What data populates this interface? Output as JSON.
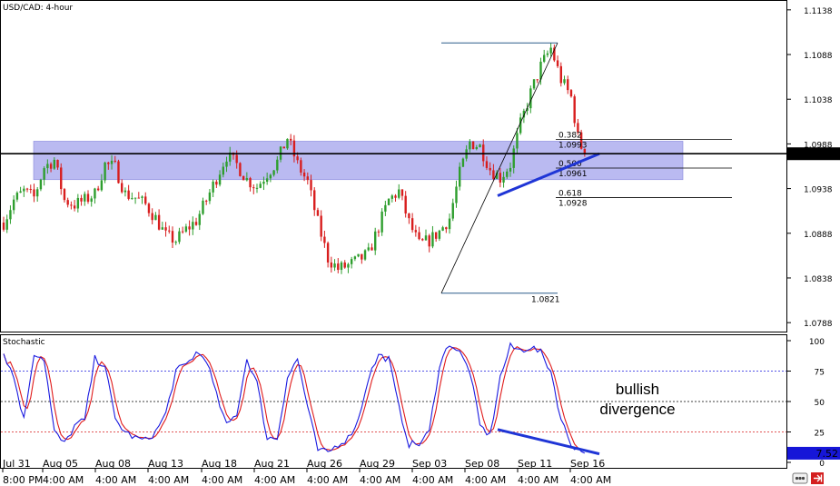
{
  "chart_data": [
    {
      "type": "candlestick",
      "title": "USD/CAD: 4-hour",
      "ylim": [
        1.0778,
        1.1148
      ],
      "y_ticks": [
        "1.1138",
        "1.1088",
        "1.1038",
        "1.0988",
        "1.0938",
        "1.0888",
        "1.0838",
        "1.0788"
      ],
      "y_tick_values": [
        1.1138,
        1.1088,
        1.1038,
        1.0988,
        1.0938,
        1.0888,
        1.0838,
        1.0788
      ],
      "current_price": "1.0977",
      "current_price_value": 1.0977,
      "support_zone": {
        "low": 1.0948,
        "high": 1.0991
      },
      "swing_low": {
        "value": 1.0821,
        "label": "1.0821"
      },
      "swing_high": {
        "value": 1.1101
      },
      "fib_levels": [
        {
          "ratio": "0.382",
          "price": "1.0993",
          "value": 1.0993
        },
        {
          "ratio": "0.500",
          "price": "1.0961",
          "value": 1.0961
        },
        {
          "ratio": "0.618",
          "price": "1.0928",
          "value": 1.0928
        }
      ],
      "anchors": [
        [
          0,
          1.09
        ],
        [
          3,
          1.0925
        ],
        [
          6,
          1.0935
        ],
        [
          9,
          1.0928
        ],
        [
          12,
          1.0962
        ],
        [
          15,
          1.097
        ],
        [
          18,
          1.0925
        ],
        [
          21,
          1.092
        ],
        [
          24,
          1.0925
        ],
        [
          27,
          1.0932
        ],
        [
          30,
          1.0965
        ],
        [
          33,
          1.0962
        ],
        [
          36,
          1.0932
        ],
        [
          39,
          1.0928
        ],
        [
          42,
          1.092
        ],
        [
          45,
          1.0905
        ],
        [
          48,
          1.0885
        ],
        [
          51,
          1.088
        ],
        [
          54,
          1.0892
        ],
        [
          57,
          1.0902
        ],
        [
          60,
          1.0925
        ],
        [
          63,
          1.095
        ],
        [
          66,
          1.0975
        ],
        [
          69,
          1.0965
        ],
        [
          72,
          1.0948
        ],
        [
          75,
          1.094
        ],
        [
          78,
          1.0955
        ],
        [
          81,
          1.0968
        ],
        [
          84,
          1.0995
        ],
        [
          87,
          1.0965
        ],
        [
          90,
          1.0945
        ],
        [
          93,
          1.09
        ],
        [
          96,
          1.086
        ],
        [
          99,
          1.0848
        ],
        [
          102,
          1.0852
        ],
        [
          105,
          1.0858
        ],
        [
          108,
          1.0865
        ],
        [
          111,
          1.0895
        ],
        [
          114,
          1.0925
        ],
        [
          117,
          1.0935
        ],
        [
          120,
          1.09
        ],
        [
          123,
          1.0875
        ],
        [
          126,
          1.088
        ],
        [
          129,
          1.089
        ],
        [
          132,
          1.0905
        ],
        [
          135,
          1.0955
        ],
        [
          138,
          1.099
        ],
        [
          141,
          1.0985
        ],
        [
          144,
          1.096
        ],
        [
          147,
          1.095
        ],
        [
          150,
          1.0965
        ],
        [
          153,
          1.101
        ],
        [
          156,
          1.1045
        ],
        [
          159,
          1.1075
        ],
        [
          162,
          1.1095
        ],
        [
          165,
          1.106
        ],
        [
          168,
          1.104
        ],
        [
          170,
          1.0995
        ],
        [
          172,
          1.0975
        ]
      ],
      "stoch_anchors": [
        [
          0,
          90
        ],
        [
          3,
          70
        ],
        [
          6,
          35
        ],
        [
          9,
          90
        ],
        [
          12,
          85
        ],
        [
          15,
          25
        ],
        [
          18,
          15
        ],
        [
          21,
          30
        ],
        [
          24,
          35
        ],
        [
          27,
          85
        ],
        [
          30,
          80
        ],
        [
          33,
          35
        ],
        [
          36,
          25
        ],
        [
          39,
          20
        ],
        [
          42,
          18
        ],
        [
          45,
          25
        ],
        [
          48,
          40
        ],
        [
          51,
          75
        ],
        [
          54,
          80
        ],
        [
          57,
          90
        ],
        [
          60,
          85
        ],
        [
          63,
          55
        ],
        [
          66,
          30
        ],
        [
          69,
          40
        ],
        [
          72,
          85
        ],
        [
          75,
          65
        ],
        [
          78,
          20
        ],
        [
          81,
          20
        ],
        [
          84,
          70
        ],
        [
          87,
          85
        ],
        [
          90,
          45
        ],
        [
          93,
          10
        ],
        [
          96,
          8
        ],
        [
          99,
          15
        ],
        [
          102,
          20
        ],
        [
          105,
          35
        ],
        [
          108,
          70
        ],
        [
          111,
          88
        ],
        [
          114,
          85
        ],
        [
          117,
          45
        ],
        [
          120,
          15
        ],
        [
          123,
          15
        ],
        [
          126,
          25
        ],
        [
          129,
          80
        ],
        [
          132,
          98
        ],
        [
          135,
          90
        ],
        [
          138,
          75
        ],
        [
          141,
          30
        ],
        [
          144,
          22
        ],
        [
          147,
          70
        ],
        [
          150,
          95
        ],
        [
          153,
          92
        ],
        [
          156,
          95
        ],
        [
          159,
          90
        ],
        [
          162,
          75
        ],
        [
          165,
          35
        ],
        [
          168,
          15
        ],
        [
          172,
          7.5
        ]
      ],
      "legend": "",
      "grid": false
    },
    {
      "type": "line",
      "title": "Stochastic",
      "ylim": [
        0,
        100
      ],
      "y_ticks": [
        "100",
        "75",
        "50",
        "25",
        "0"
      ],
      "y_tick_values": [
        100,
        75,
        50,
        25,
        0
      ],
      "current_value": "7.52",
      "current_value_num": 7.52,
      "levels": [
        75,
        50,
        25
      ]
    }
  ],
  "annotation": [
    "bullish",
    "divergence"
  ],
  "x_date_labels": [
    "Jul 31",
    "Aug 05",
    "Aug 08",
    "Aug 13",
    "Aug 18",
    "Aug 21",
    "Aug 26",
    "Aug 29",
    "Sep 03",
    "Sep 08",
    "Sep 11",
    "Sep 16"
  ],
  "x_time_labels": [
    "8:00 PM",
    "4:00 AM",
    "4:00 AM",
    "4:00 AM",
    "4:00 AM",
    "4:00 AM",
    "4:00 AM",
    "4:00 AM",
    "4:00 AM",
    "4:00 AM",
    "4:00 AM",
    "4:00 AM"
  ],
  "colors": {
    "up": "#2e9e2e",
    "down": "#d81e1e",
    "zone": "#a9a9ee",
    "fib": "#2b5d8a",
    "trendline": "#1f35d6",
    "stoch_k": "#1a1ae0",
    "stoch_d": "#e01a1a",
    "price_box": "#000000",
    "stoch_box": "#1616d8"
  },
  "icons": {
    "toolbar_left": "scroll-icon",
    "toolbar_right": "arrow-right-icon"
  }
}
